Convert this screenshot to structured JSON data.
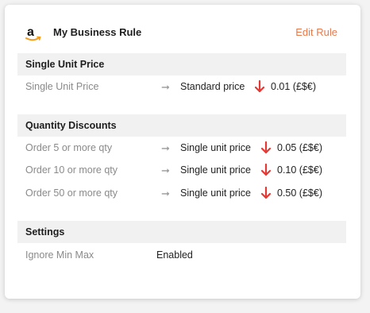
{
  "header": {
    "logo_icon": "amazon-logo-icon",
    "title": "My Business Rule",
    "edit_label": "Edit Rule",
    "accent_color": "#e8794b"
  },
  "sections": [
    {
      "title": "Single Unit Price",
      "rows": [
        {
          "label": "Single Unit Price",
          "target": "Standard price",
          "change": "0.01 (£$€)"
        }
      ]
    },
    {
      "title": "Quantity Discounts",
      "rows": [
        {
          "label": "Order 5 or more qty",
          "target": "Single unit price",
          "change": "0.05 (£$€)"
        },
        {
          "label": "Order 10 or more qty",
          "target": "Single unit price",
          "change": "0.10 (£$€)"
        },
        {
          "label": "Order 50 or more qty",
          "target": "Single unit price",
          "change": "0.50 (£$€)"
        }
      ]
    },
    {
      "title": "Settings",
      "rows": [
        {
          "label": "Ignore Min Max",
          "value": "Enabled"
        }
      ]
    }
  ],
  "icons": {
    "arrow_right": "arrow-right-icon",
    "arrow_down": "arrow-down-icon",
    "decrease_color": "#e53935"
  }
}
